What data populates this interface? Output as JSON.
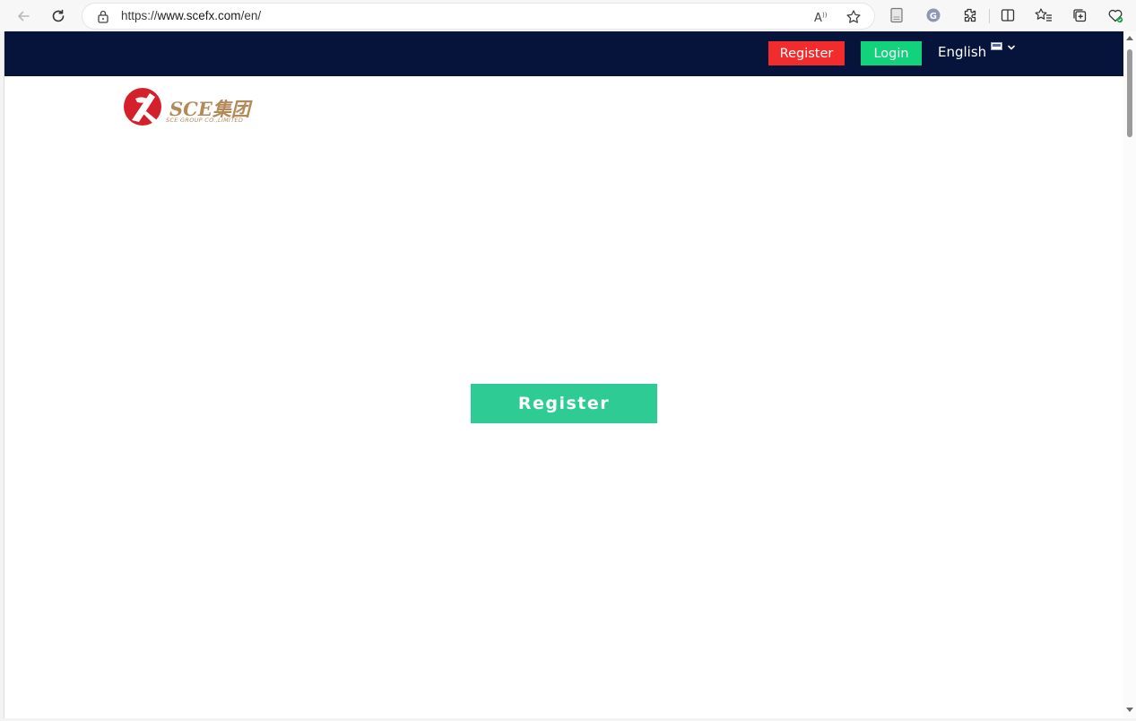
{
  "browser": {
    "url_scheme": "https://",
    "url_host": "www.scefx.com",
    "url_path": "/en/",
    "icons": [
      "back-arrow-icon",
      "refresh-icon",
      "lock-icon",
      "read-aloud-icon",
      "favorite-star-icon",
      "document-icon",
      "copilot-icon",
      "extensions-icon",
      "split-screen-icon",
      "favorites-icon",
      "collections-icon",
      "browser-essentials-icon"
    ]
  },
  "header": {
    "register_label": "Register",
    "login_label": "Login",
    "language_label": "English",
    "colors": {
      "background": "#06133a",
      "register": "#f22c2c",
      "login": "#13d27c"
    }
  },
  "logo": {
    "name": "SCE集团",
    "subtitle": "SCE GROUP CO.,LIMITED",
    "colors": {
      "mark": "#d4202a",
      "text": "#b4895a"
    }
  },
  "main": {
    "register_label": "Register",
    "color": "#2ecb94"
  }
}
